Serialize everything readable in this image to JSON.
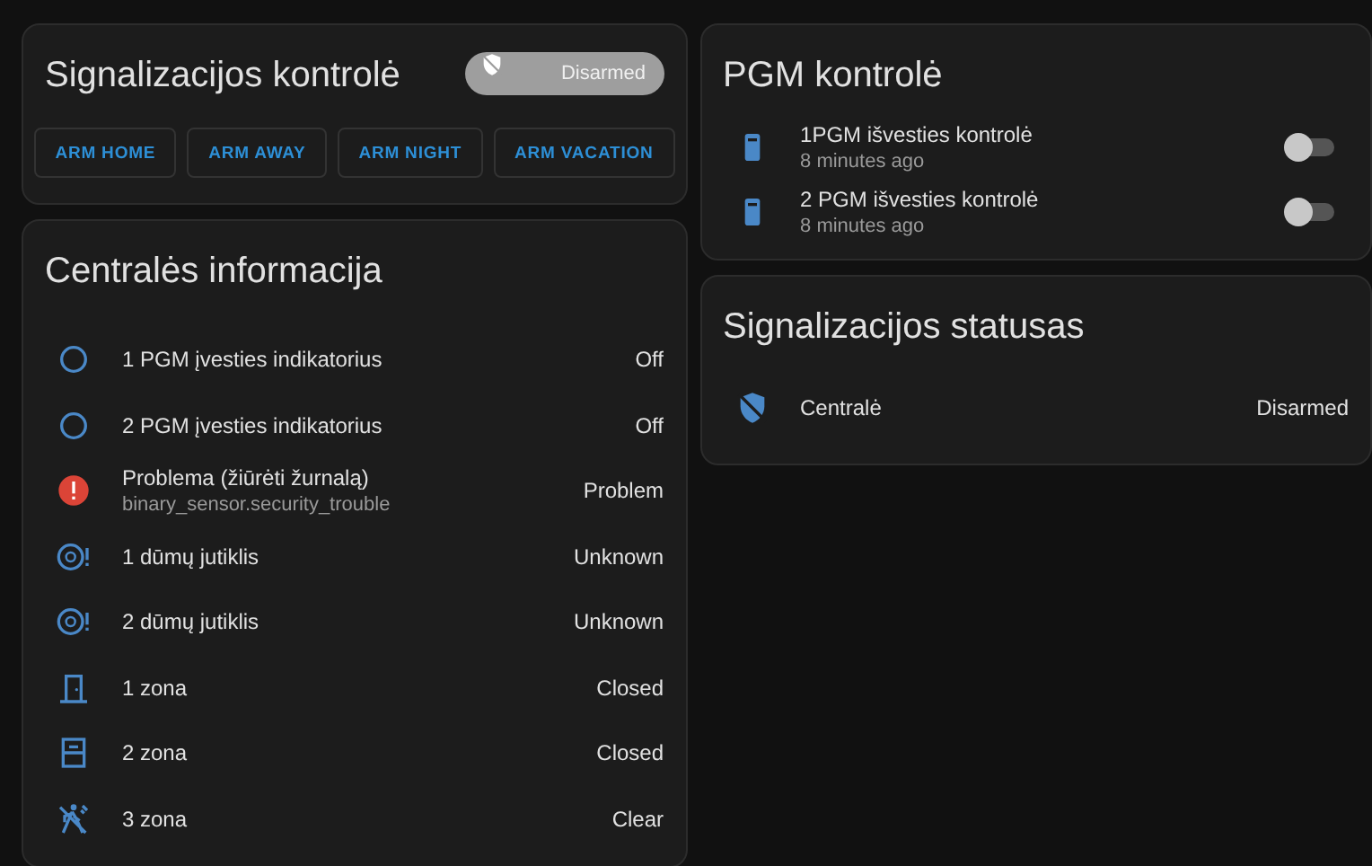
{
  "alarm_panel": {
    "title": "Signalizacijos kontrolė",
    "state_badge": "Disarmed",
    "buttons": [
      "ARM HOME",
      "ARM AWAY",
      "ARM NIGHT",
      "ARM VACATION"
    ]
  },
  "panel_info": {
    "title": "Centralės informacija",
    "rows": [
      {
        "kind": "circle",
        "name": "1 PGM įvesties indikatorius",
        "state": "Off"
      },
      {
        "kind": "circle",
        "name": "2 PGM įvesties indikatorius",
        "state": "Off"
      },
      {
        "kind": "alert",
        "name": "Problema (žiūrėti žurnalą)",
        "secondary": "binary_sensor.security_trouble",
        "state": "Problem"
      },
      {
        "kind": "smoke",
        "name": "1 dūmų jutiklis",
        "state": "Unknown"
      },
      {
        "kind": "smoke",
        "name": "2 dūmų jutiklis",
        "state": "Unknown"
      },
      {
        "kind": "door",
        "name": "1 zona",
        "state": "Closed"
      },
      {
        "kind": "window",
        "name": "2 zona",
        "state": "Closed"
      },
      {
        "kind": "motion",
        "name": "3 zona",
        "state": "Clear"
      }
    ]
  },
  "pgm_control": {
    "title": "PGM kontrolė",
    "rows": [
      {
        "kind": "remote",
        "name": "1PGM išvesties kontrolė",
        "secondary": "8 minutes ago",
        "on": false
      },
      {
        "kind": "remote",
        "name": "2 PGM išvesties kontrolė",
        "secondary": "8 minutes ago",
        "on": false
      }
    ]
  },
  "alarm_status": {
    "title": "Signalizacijos statusas",
    "rows": [
      {
        "kind": "shield-off",
        "name": "Centralė",
        "state": "Disarmed"
      }
    ]
  }
}
